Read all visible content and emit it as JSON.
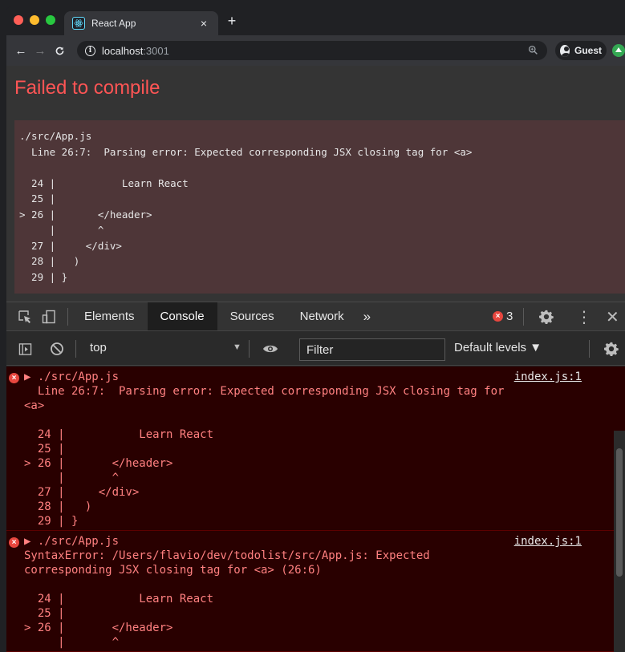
{
  "browser": {
    "tab_title": "React App",
    "tab_close": "×",
    "new_tab": "+",
    "url_host": "localhost",
    "url_port": ":3001",
    "guest_label": "Guest"
  },
  "overlay": {
    "title": "Failed to compile",
    "file": "./src/App.js",
    "message": "  Line 26:7:  Parsing error: Expected corresponding JSX closing tag for <a>",
    "code_lines": [
      "  24 |           Learn React",
      "  25 |",
      "> 26 |       </header>",
      "     |       ^",
      "  27 |     </div>",
      "  28 |   )",
      "  29 | }"
    ]
  },
  "devtools": {
    "tabs": [
      "Elements",
      "Console",
      "Sources",
      "Network"
    ],
    "more_tabs": "»",
    "error_count": "3",
    "context": "top",
    "filter_placeholder": "Filter",
    "levels": "Default levels ▼"
  },
  "console": {
    "messages": [
      {
        "source": "index.js:1",
        "text": "▶ ./src/App.js\n  Line 26:7:  Parsing error: Expected corresponding JSX closing tag for\n<a>\n\n  24 |           Learn React\n  25 |\n> 26 |       </header>\n     |       ^\n  27 |     </div>\n  28 |   )\n  29 | }"
      },
      {
        "source": "index.js:1",
        "text": "▶ ./src/App.js\nSyntaxError: /Users/flavio/dev/todolist/src/App.js: Expected\ncorresponding JSX closing tag for <a> (26:6)\n\n  24 |           Learn React\n  25 |\n> 26 |       </header>\n     |       ^"
      }
    ]
  },
  "colors": {
    "error_red": "#ff5555",
    "console_bg": "#290000",
    "overlay_box": "#4e3638"
  },
  "icons": [
    "react-favicon",
    "back-arrow-icon",
    "forward-arrow-icon",
    "reload-icon",
    "info-icon",
    "zoom-icon",
    "guest-avatar-icon",
    "extension-icon",
    "inspect-element-icon",
    "device-toolbar-icon",
    "gear-icon",
    "kebab-menu-icon",
    "close-icon",
    "sidebar-toggle-icon",
    "clear-console-icon",
    "eye-icon",
    "error-icon"
  ]
}
